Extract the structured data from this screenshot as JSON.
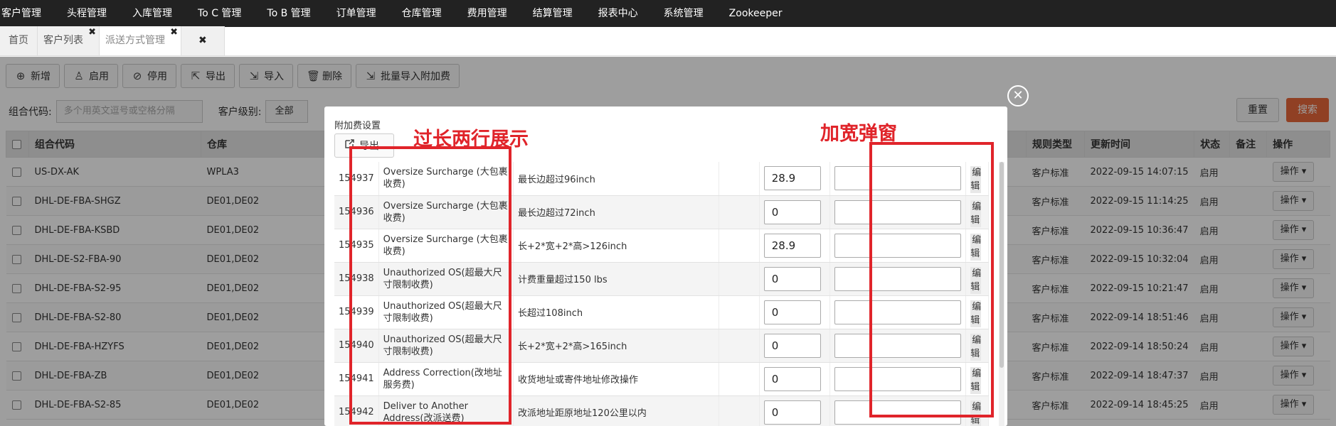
{
  "topnav": [
    "客户管理",
    "头程管理",
    "入库管理",
    "To C 管理",
    "To B 管理",
    "订单管理",
    "仓库管理",
    "费用管理",
    "结算管理",
    "报表中心",
    "系统管理",
    "Zookeeper"
  ],
  "tabs": [
    {
      "label": "首页",
      "closable": false
    },
    {
      "label": "客户列表",
      "closable": true
    },
    {
      "label": "派送方式管理",
      "closable": true,
      "active": true
    }
  ],
  "tab_close_all": "✖",
  "toolbar": [
    {
      "label": "新增",
      "icon": "plus-circle-icon"
    },
    {
      "label": "启用",
      "icon": "user-icon"
    },
    {
      "label": "停用",
      "icon": "ban-icon"
    },
    {
      "label": "导出",
      "icon": "export-icon"
    },
    {
      "label": "导入",
      "icon": "import-icon"
    },
    {
      "label": "删除",
      "icon": "trash-icon"
    },
    {
      "label": "批量导入附加费",
      "icon": "import-icon"
    }
  ],
  "filters": {
    "code_label": "组合代码:",
    "code_placeholder": "多个用英文逗号或空格分隔",
    "level_label": "客户级别:",
    "level_value": "全部",
    "reset": "重置",
    "search": "搜索"
  },
  "grid": {
    "headers": [
      "组合代码",
      "仓库",
      "规则类型",
      "更新时间",
      "状态",
      "备注",
      "操作"
    ],
    "rows": [
      {
        "code": "US-DX-AK",
        "wh": "WPLA3",
        "rule": "客户标准",
        "time": "2022-09-15 14:07:15",
        "status": "启用"
      },
      {
        "code": "DHL-DE-FBA-SHGZ",
        "wh": "DE01,DE02",
        "rule": "客户标准",
        "time": "2022-09-15 11:14:25",
        "status": "启用"
      },
      {
        "code": "DHL-DE-FBA-KSBD",
        "wh": "DE01,DE02",
        "rule": "客户标准",
        "time": "2022-09-15 10:36:47",
        "status": "启用"
      },
      {
        "code": "DHL-DE-S2-FBA-90",
        "wh": "DE01,DE02",
        "rule": "客户标准",
        "time": "2022-09-15 10:32:04",
        "status": "启用"
      },
      {
        "code": "DHL-DE-FBA-S2-95",
        "wh": "DE01,DE02",
        "rule": "客户标准",
        "time": "2022-09-15 10:21:47",
        "status": "启用"
      },
      {
        "code": "DHL-DE-FBA-S2-80",
        "wh": "DE01,DE02",
        "rule": "客户标准",
        "time": "2022-09-14 18:51:46",
        "status": "启用"
      },
      {
        "code": "DHL-DE-FBA-HZYFS",
        "wh": "DE01,DE02",
        "rule": "客户标准",
        "time": "2022-09-14 18:50:24",
        "status": "启用"
      },
      {
        "code": "DHL-DE-FBA-ZB",
        "wh": "DE01,DE02",
        "rule": "客户标准",
        "time": "2022-09-14 18:47:37",
        "status": "启用"
      },
      {
        "code": "DHL-DE-FBA-S2-85",
        "wh": "DE01,DE02",
        "rule": "客户标准",
        "time": "2022-09-14 18:45:25",
        "status": "启用"
      }
    ],
    "op_label": "操作 ▾"
  },
  "modal": {
    "title": "附加费设置",
    "export": "导出",
    "close": "✕",
    "edit_label": "编辑",
    "rows": [
      {
        "id": "154937",
        "name": "Oversize Surcharge (大包裹收费)",
        "desc": "最长边超过96inch",
        "value": "28.9"
      },
      {
        "id": "154936",
        "name": "Oversize Surcharge (大包裹收费)",
        "desc": "最长边超过72inch",
        "value": "0"
      },
      {
        "id": "154935",
        "name": "Oversize Surcharge (大包裹收费)",
        "desc": "长+2*宽+2*高>126inch",
        "value": "28.9"
      },
      {
        "id": "154938",
        "name": "Unauthorized OS(超最大尺寸限制收费)",
        "desc": "计费重量超过150 lbs",
        "value": "0"
      },
      {
        "id": "154939",
        "name": "Unauthorized OS(超最大尺寸限制收费)",
        "desc": "长超过108inch",
        "value": "0"
      },
      {
        "id": "154940",
        "name": "Unauthorized OS(超最大尺寸限制收费)",
        "desc": "长+2*宽+2*高>165inch",
        "value": "0"
      },
      {
        "id": "154941",
        "name": "Address Correction(改地址服务费)",
        "desc": "收货地址或寄件地址修改操作",
        "value": "0"
      },
      {
        "id": "154942",
        "name": "Deliver to Another Address(改派送费)",
        "desc": "改派地址距原地址120公里以内",
        "value": "0"
      }
    ]
  },
  "annotations": {
    "left_text": "过长两行展示",
    "right_text": "加宽弹窗",
    "color": "#e0242a"
  }
}
